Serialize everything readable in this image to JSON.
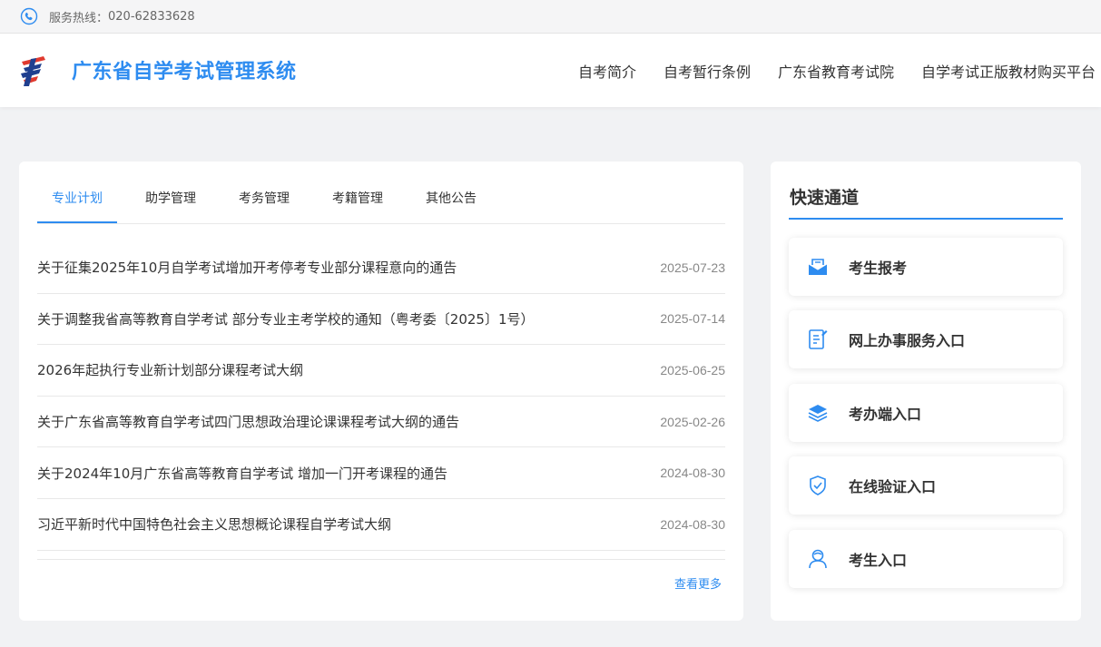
{
  "topbar": {
    "hotline_label": "服务热线：",
    "hotline_number": "020-62833628"
  },
  "header": {
    "title": "广东省自学考试管理系统",
    "nav": [
      "自考简介",
      "自考暂行条例",
      "广东省教育考试院",
      "自学考试正版教材购买平台"
    ]
  },
  "tabs": [
    "专业计划",
    "助学管理",
    "考务管理",
    "考籍管理",
    "其他公告"
  ],
  "active_tab": "专业计划",
  "notices": [
    {
      "title": "关于征集2025年10月自学考试增加开考停考专业部分课程意向的通告",
      "date": "2025-07-23"
    },
    {
      "title": "关于调整我省高等教育自学考试 部分专业主考学校的通知（粤考委〔2025〕1号）",
      "date": "2025-07-14"
    },
    {
      "title": "2026年起执行专业新计划部分课程考试大纲",
      "date": "2025-06-25"
    },
    {
      "title": "关于广东省高等教育自学考试四门思想政治理论课课程考试大纲的通告",
      "date": "2025-02-26"
    },
    {
      "title": "关于2024年10月广东省高等教育自学考试 增加一门开考课程的通告",
      "date": "2024-08-30"
    },
    {
      "title": "习近平新时代中国特色社会主义思想概论课程自学考试大纲",
      "date": "2024-08-30"
    }
  ],
  "more_label": "查看更多",
  "quick": {
    "title": "快速通道",
    "items": [
      {
        "label": "考生报考",
        "icon": "envelope-icon"
      },
      {
        "label": "网上办事服务入口",
        "icon": "document-edit-icon"
      },
      {
        "label": "考办端入口",
        "icon": "layers-icon"
      },
      {
        "label": "在线验证入口",
        "icon": "shield-check-icon"
      },
      {
        "label": "考生入口",
        "icon": "user-icon"
      }
    ]
  },
  "colors": {
    "accent": "#2e8cf0",
    "background": "#f1f2f4",
    "logo_red": "#e03a2f",
    "logo_navy": "#1f3f8f"
  }
}
